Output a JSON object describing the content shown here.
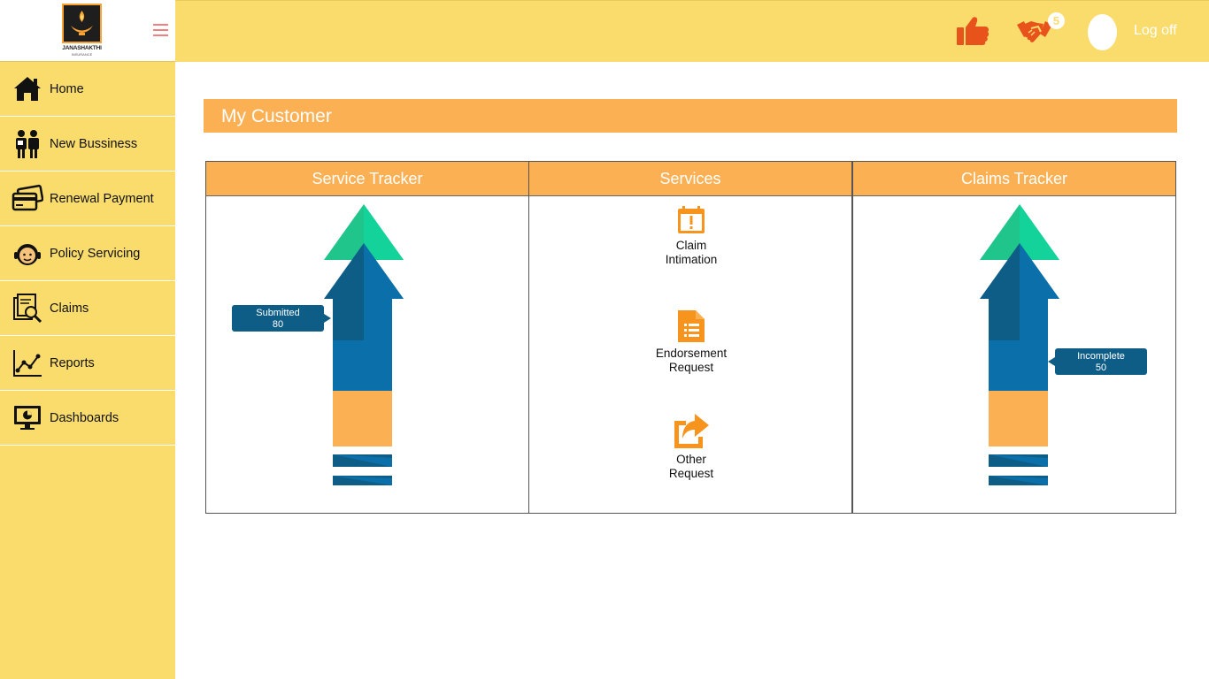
{
  "app": {
    "logo_text": "JANASHAKTHI",
    "logo_sub": "INSURANCE"
  },
  "sidebar": {
    "items": [
      {
        "label": "Home",
        "icon": "home-icon"
      },
      {
        "label": "New Bussiness",
        "icon": "people-icon"
      },
      {
        "label": "Renewal Payment",
        "icon": "credit-card-icon"
      },
      {
        "label": "Policy Servicing",
        "icon": "headset-icon"
      },
      {
        "label": "Claims",
        "icon": "claims-icon"
      },
      {
        "label": "Reports",
        "icon": "line-chart-icon"
      },
      {
        "label": "Dashboards",
        "icon": "monitor-icon"
      }
    ]
  },
  "header": {
    "notification_count": "5",
    "logoff_label": "Log off"
  },
  "main": {
    "title": "My Customer",
    "panels": {
      "service_tracker": {
        "title": "Service Tracker",
        "callout_label": "Submitted",
        "callout_value": "80"
      },
      "services": {
        "title": "Services",
        "items": [
          {
            "line1": "Claim",
            "line2": "Intimation",
            "icon": "calendar-alert-icon"
          },
          {
            "line1": "Endorsement",
            "line2": "Request",
            "icon": "document-list-icon"
          },
          {
            "line1": "Other",
            "line2": "Request",
            "icon": "share-icon"
          }
        ]
      },
      "claims_tracker": {
        "title": "Claims Tracker",
        "callout_label": "Incomplete",
        "callout_value": "50"
      }
    }
  },
  "colors": {
    "sidebar_bg": "#f9dc6c",
    "header_bg": "#fbb054",
    "dark_blue": "#0e5d87",
    "mid_blue": "#0b70aa",
    "green": "#20c58c",
    "orange_icon": "#f7941d"
  }
}
